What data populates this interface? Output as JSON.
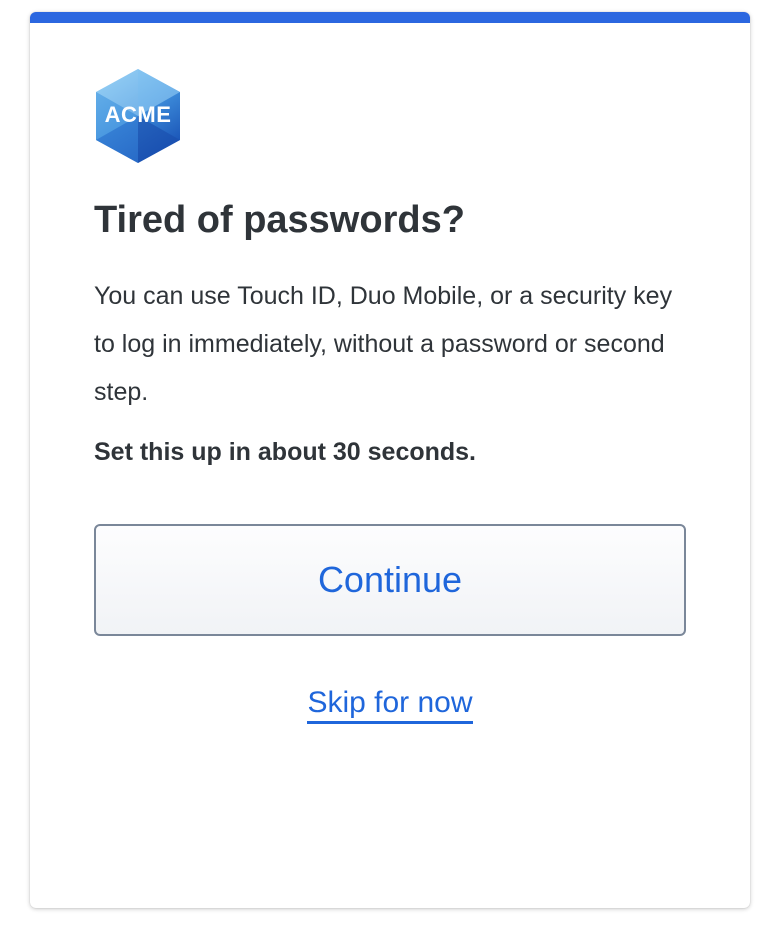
{
  "logo": {
    "text": "ACME",
    "icon": "acme-hexagon-logo"
  },
  "heading": "Tired of passwords?",
  "body": "You can use Touch ID, Duo Mobile, or a security key to log in immediately, without a password or second step.",
  "emphasis": "Set this up in about 30 seconds.",
  "continue_label": "Continue",
  "skip_label": "Skip for now",
  "colors": {
    "accent": "#2b67e0",
    "link": "#1f66db",
    "text": "#2f3439",
    "button_border": "#7a8799"
  }
}
